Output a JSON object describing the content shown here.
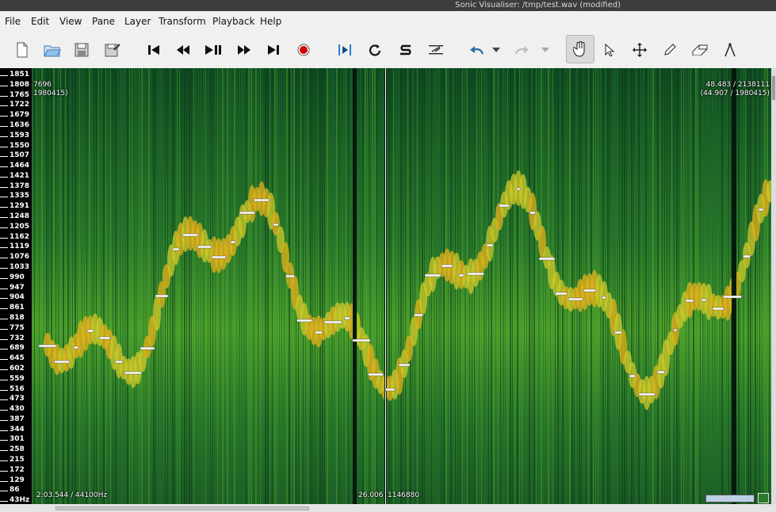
{
  "window": {
    "title": "Sonic Visualiser: /tmp/test.wav (modified)"
  },
  "menu": [
    {
      "label": "File",
      "name": "menu-file"
    },
    {
      "label": "Edit",
      "name": "menu-edit"
    },
    {
      "label": "View",
      "name": "menu-view"
    },
    {
      "label": "Pane",
      "name": "menu-pane"
    },
    {
      "label": "Layer",
      "name": "menu-layer"
    },
    {
      "label": "Transform",
      "name": "menu-transform"
    },
    {
      "label": "Playback",
      "name": "menu-playback"
    },
    {
      "label": "Help",
      "name": "menu-help"
    }
  ],
  "toolbar": {
    "buttons": [
      {
        "icon": "new-file-icon"
      },
      {
        "icon": "open-folder-icon"
      },
      {
        "icon": "save-icon"
      },
      {
        "icon": "save-as-icon"
      },
      {
        "icon": "rewind-start-icon"
      },
      {
        "icon": "rewind-icon"
      },
      {
        "icon": "play-pause-icon"
      },
      {
        "icon": "fast-forward-icon"
      },
      {
        "icon": "fast-forward-end-icon"
      },
      {
        "icon": "record-icon"
      },
      {
        "icon": "play-selection-icon"
      },
      {
        "icon": "loop-icon"
      },
      {
        "icon": "solo-icon"
      },
      {
        "icon": "align-icon"
      },
      {
        "icon": "undo-icon"
      },
      {
        "icon": "undo-dropdown-icon"
      },
      {
        "icon": "redo-icon"
      },
      {
        "icon": "redo-dropdown-icon"
      },
      {
        "icon": "navigate-hand-icon",
        "active": true
      },
      {
        "icon": "select-arrow-icon"
      },
      {
        "icon": "move-icon"
      },
      {
        "icon": "draw-pencil-icon"
      },
      {
        "icon": "erase-icon"
      },
      {
        "icon": "measure-icon"
      }
    ]
  },
  "scale": {
    "labels": [
      "1851",
      "1808",
      "1765",
      "1722",
      "1679",
      "1636",
      "1593",
      "1550",
      "1507",
      "1464",
      "1421",
      "1378",
      "1335",
      "1291",
      "1248",
      "1205",
      "1162",
      "1119",
      "1076",
      "1033",
      "990",
      "947",
      "904",
      "861",
      "818",
      "775",
      "732",
      "689",
      "645",
      "602",
      "559",
      "516",
      "473",
      "430",
      "387",
      "344",
      "301",
      "258",
      "215",
      "172",
      "129",
      "86",
      "43Hz"
    ]
  },
  "overlays": {
    "top_left_value": "7696",
    "top_left_sub": "1980415)",
    "top_right_value": "48.483 / 2138111",
    "top_right_sub": "(44.907 / 1980415)",
    "bottom_left": "2:03.544 / 44100Hz",
    "bottom_mid_time": "26.006",
    "bottom_mid_frame": "1146880"
  },
  "colors": {
    "spectrogram_low": "#1a5a2a",
    "spectrogram_mid": "#4fa12a",
    "spectrogram_high": "#e5b11c",
    "note_fill": "#ffffff",
    "record": "#d40000",
    "toolbar_blue": "#2d7dd2"
  }
}
